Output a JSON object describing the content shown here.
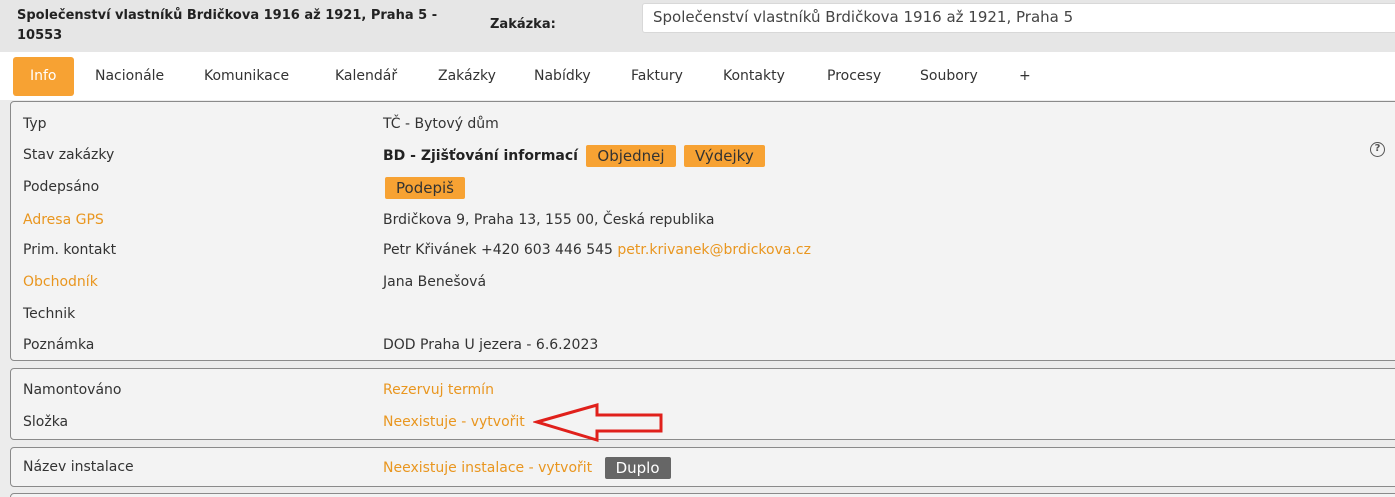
{
  "header": {
    "title": "Společenství vlastníků Brdičkova 1916 až 1921, Praha 5 - 10553",
    "zakazka_label": "Zakázka:",
    "zakazka_value": "Společenství vlastníků Brdičkova 1916 až 1921, Praha 5"
  },
  "tabs": [
    {
      "label": "Info",
      "active": true
    },
    {
      "label": "Nacionále"
    },
    {
      "label": "Komunikace"
    },
    {
      "label": "Kalendář"
    },
    {
      "label": "Zakázky"
    },
    {
      "label": "Nabídky"
    },
    {
      "label": "Faktury"
    },
    {
      "label": "Kontakty"
    },
    {
      "label": "Procesy"
    },
    {
      "label": "Soubory"
    },
    {
      "label": "+"
    }
  ],
  "info": {
    "typ_label": "Typ",
    "typ_value": "TČ - Bytový dům",
    "stav_label": "Stav zakázky",
    "stav_value": "BD - Zjišťování informací",
    "objednej_button": "Objednej",
    "vydejky_button": "Výdejky",
    "podepsano_label": "Podepsáno",
    "podepis_button": "Podepiš",
    "adresa_label": "Adresa GPS",
    "adresa_value": "Brdičkova 9, Praha 13, 155 00, Česká republika",
    "kontakt_label": "Prim. kontakt",
    "kontakt_value": "Petr Křivánek +420 603 446 545",
    "kontakt_email": "petr.krivanek@brdickova.cz",
    "obchodnik_label": "Obchodník",
    "obchodnik_value": "Jana Benešová",
    "technik_label": "Technik",
    "poznamka_label": "Poznámka",
    "poznamka_value": "DOD Praha U jezera - 6.6.2023"
  },
  "montaz": {
    "namontovano_label": "Namontováno",
    "namontovano_link": "Rezervuj termín",
    "slozka_label": "Složka",
    "slozka_link": "Neexistuje - vytvořit"
  },
  "instalace": {
    "nazev_label": "Název instalace",
    "nazev_link": "Neexistuje instalace - vytvořit",
    "duplo_button": "Duplo"
  },
  "colors": {
    "accent": "#f7a233",
    "link": "#e9961f",
    "arrow": "#e0201b"
  },
  "icons": {
    "help": "help-circle-icon",
    "annotation": "red-arrow-icon"
  }
}
